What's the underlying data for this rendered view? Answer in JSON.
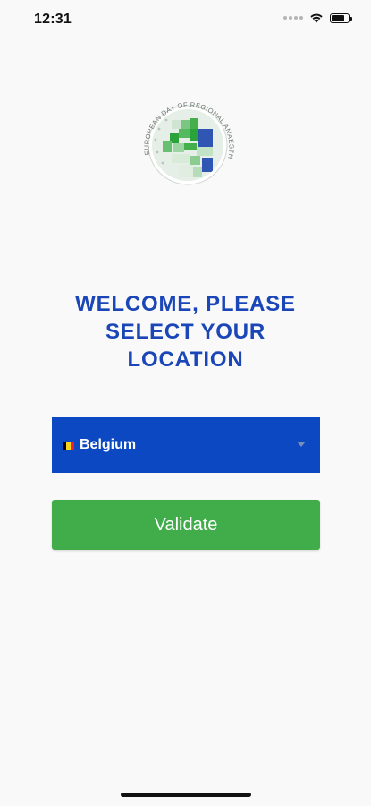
{
  "status_bar": {
    "time": "12:31",
    "battery_level": 0.85
  },
  "logo": {
    "ring_text": "EUROPEAN DAY OF REGIONAL ANAESTHESIA"
  },
  "heading": {
    "text": "WELCOME, PLEASE SELECT YOUR LOCATION"
  },
  "location_select": {
    "selected_value": "Belgium",
    "flag_colors": [
      "#000000",
      "#f6d31f",
      "#e8212e"
    ]
  },
  "validate_button": {
    "label": "Validate"
  },
  "colors": {
    "primary_blue": "#0b48c2",
    "heading_blue": "#1a46b8",
    "validate_green": "#41ad4a",
    "background": "#f9f9f9"
  }
}
